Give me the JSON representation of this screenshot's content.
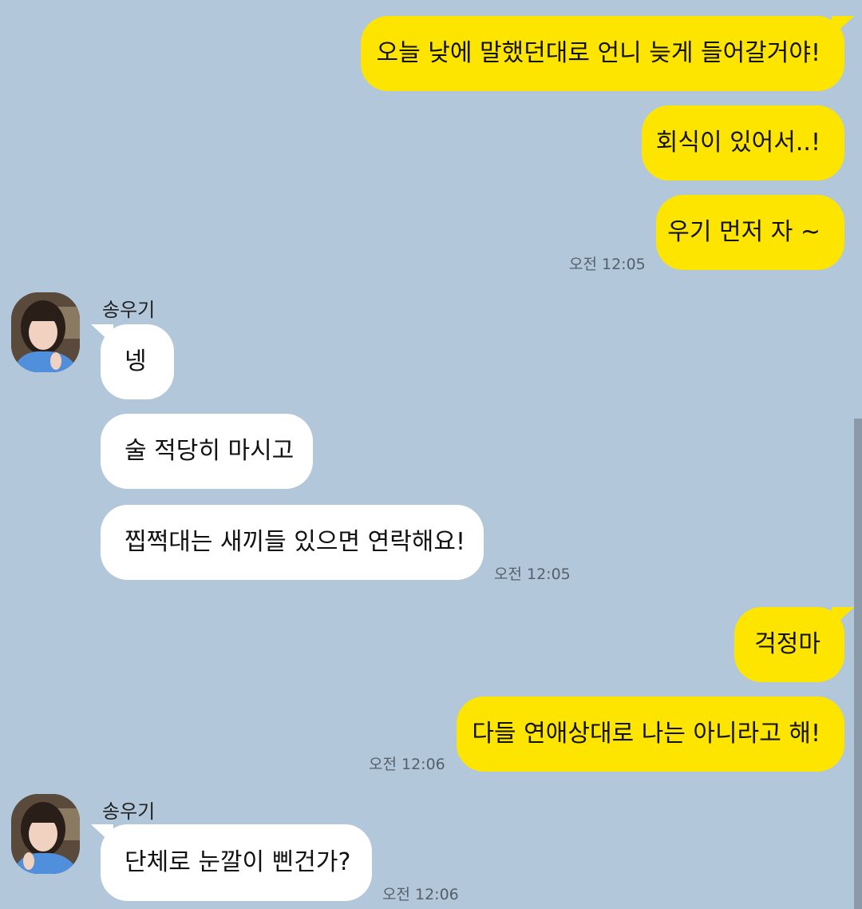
{
  "messages": {
    "m1": "오늘 낮에 말했던대로 언니 늦게 들어갈거야!",
    "m2": "회식이 있어서..!",
    "m3": "우기 먼저 자 ~",
    "t1": "오전 12:05",
    "sender1": "송우기",
    "r1": "넹",
    "r2": "술 적당히 마시고",
    "r3": "찝쩍대는 새끼들 있으면 연락해요!",
    "t2": "오전 12:05",
    "m4": "걱정마",
    "m5": "다들 연애상대로 나는 아니라고 해!",
    "t3": "오전 12:06",
    "sender2": "송우기",
    "r4": "단체로 눈깔이 삔건가?",
    "t4": "오전 12:06"
  },
  "colors": {
    "background": "#b2c7da",
    "my_bubble": "#fee500",
    "their_bubble": "#ffffff"
  },
  "icons": {
    "avatar": "profile-photo"
  }
}
